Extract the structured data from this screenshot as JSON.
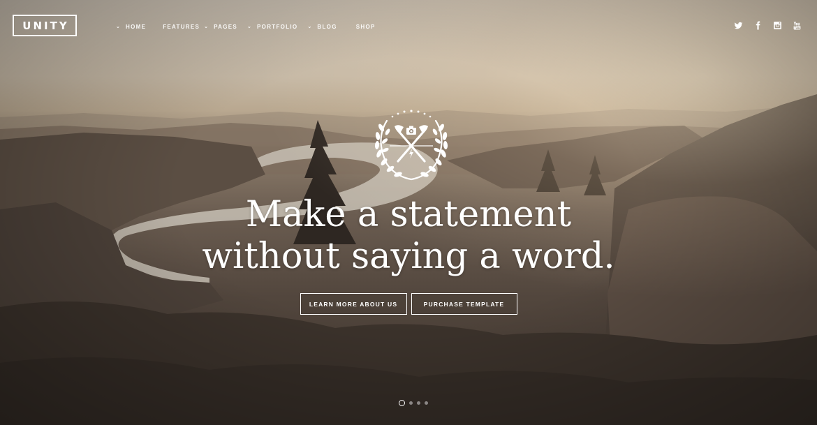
{
  "brand": {
    "logo_text": "UNITY"
  },
  "nav": {
    "items": [
      {
        "label": "HOME",
        "has_dropdown": true
      },
      {
        "label": "FEATURES",
        "has_dropdown": false
      },
      {
        "label": "PAGES",
        "has_dropdown": true
      },
      {
        "label": "PORTFOLIO",
        "has_dropdown": true
      },
      {
        "label": "BLOG",
        "has_dropdown": true
      },
      {
        "label": "SHOP",
        "has_dropdown": false
      }
    ],
    "dropdown_glyph": "⌄"
  },
  "social": {
    "icons": [
      "twitter-icon",
      "facebook-icon",
      "instagram-icon",
      "youtube-icon"
    ]
  },
  "hero": {
    "emblem_icon": "crossed-axes-camera-laurel-emblem-icon",
    "headline_line1": "Make a statement",
    "headline_line2": "without saying a word.",
    "button_learn": "LEARN MORE ABOUT US",
    "button_purchase": "PURCHASE TEMPLATE"
  },
  "slider": {
    "total": 4,
    "active": 1
  },
  "colors": {
    "text": "#ffffff",
    "sky": "#c9bfb1",
    "forest": "#3f352e"
  }
}
